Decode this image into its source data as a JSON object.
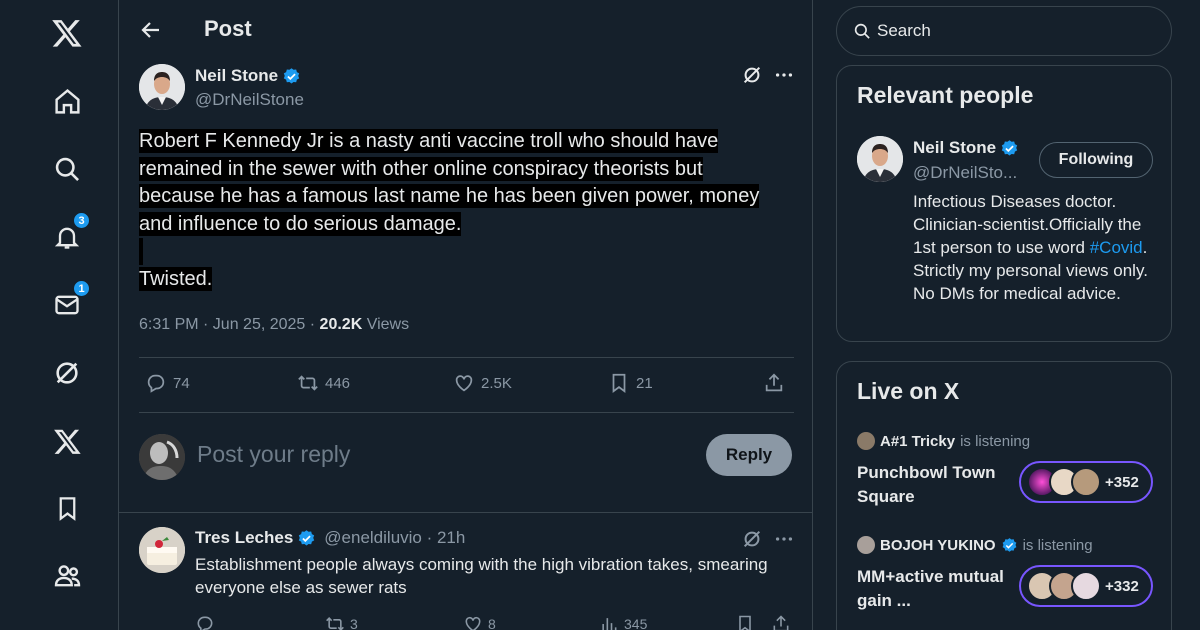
{
  "nav": {
    "notifications_badge": "3",
    "messages_badge": "1"
  },
  "header": {
    "title": "Post"
  },
  "post": {
    "author_name": "Neil Stone",
    "author_handle": "@DrNeilStone",
    "text_lines": [
      "Robert F Kennedy Jr is a nasty anti vaccine troll who should have",
      "remained in the sewer with other online conspiracy theorists but",
      "because he has a famous last name he has been given power, money",
      "and influence to do serious damage.",
      "Twisted."
    ],
    "time_date": "6:31 PM · Jun 25, 2025 · ",
    "views_count": "20.2K",
    "views_label": " Views",
    "stats": {
      "replies": "74",
      "reposts": "446",
      "likes": "2.5K",
      "bookmarks": "21"
    }
  },
  "reply_box": {
    "placeholder": "Post your reply",
    "button": "Reply"
  },
  "reply": {
    "name": "Tres Leches",
    "handle": "@eneldiluvio · 21h",
    "text": "Establishment people always coming with the high vibration takes, smearing everyone else as sewer rats",
    "stats": {
      "replies": "",
      "reposts": "3",
      "likes": "8",
      "views": "345"
    }
  },
  "sidebar": {
    "search_placeholder": "Search",
    "relevant": {
      "title": "Relevant people",
      "name": "Neil Stone",
      "handle": "@DrNeilSto...",
      "follow_label": "Following",
      "bio_pre": "Infectious Diseases doctor. Clinician-scientist.Officially the 1st person to use word ",
      "bio_hashtag": "#Covid",
      "bio_post": ". Strictly my personal views only. No DMs for medical advice."
    },
    "live": {
      "title": "Live on X",
      "spaces": [
        {
          "host": "A#1 Tricky",
          "status": "is listening",
          "title": "Punchbowl Town Square",
          "count": "+352"
        },
        {
          "host": "BOJOH YUKINO",
          "status": "is listening",
          "title": "MM+active mutual gain ...",
          "count": "+332"
        }
      ]
    }
  },
  "colors": {
    "background": "#15202b",
    "accent": "#1d9bf0",
    "muted": "#8b98a5",
    "space_purple": "#7856ff"
  }
}
